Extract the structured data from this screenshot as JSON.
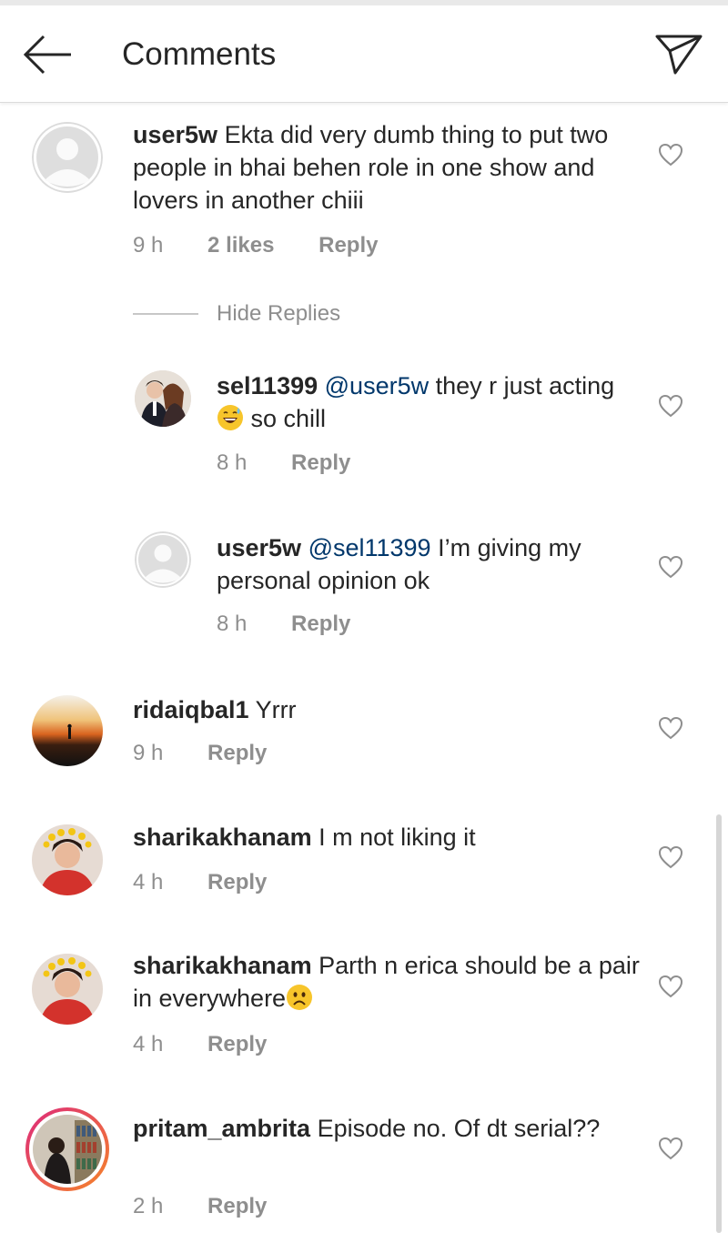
{
  "header": {
    "title": "Comments",
    "back_icon": "arrow-left-icon",
    "share_icon": "paper-plane-icon"
  },
  "hide_replies_label": "Hide Replies",
  "comments": [
    {
      "username": "user5w",
      "text": "Ekta did very dumb thing to put two people in bhai behen role in one show and lovers in another chiii",
      "time": "9 h",
      "likes": "2 likes",
      "reply_label": "Reply"
    },
    {
      "username": "sel11399",
      "mention": "@user5w",
      "text_before_emoji": "they r just acting",
      "emoji": "grinning-sweat-emoji",
      "text_after_emoji": " so chill",
      "time": "8 h",
      "reply_label": "Reply"
    },
    {
      "username": "user5w",
      "mention": "@sel11399",
      "text": "I’m giving my personal opinion ok",
      "time": "8 h",
      "reply_label": "Reply"
    },
    {
      "username": "ridaiqbal1",
      "text": "Yrrr",
      "time": "9 h",
      "reply_label": "Reply"
    },
    {
      "username": "sharikakhanam",
      "text": "I m not liking it",
      "time": "4 h",
      "reply_label": "Reply"
    },
    {
      "username": "sharikakhanam",
      "text": "Parth n erica should be a pair in everywhere",
      "emoji": "worried-face-emoji",
      "time": "4 h",
      "reply_label": "Reply"
    },
    {
      "username": "pritam_ambrita",
      "text": "Episode no. Of dt serial??",
      "time": "2 h",
      "reply_label": "Reply"
    }
  ],
  "colors": {
    "text": "#262626",
    "secondary": "#8e8e8e",
    "mention": "#00376b",
    "story_ring_start": "#f58529",
    "story_ring_end": "#dd2a7b"
  }
}
